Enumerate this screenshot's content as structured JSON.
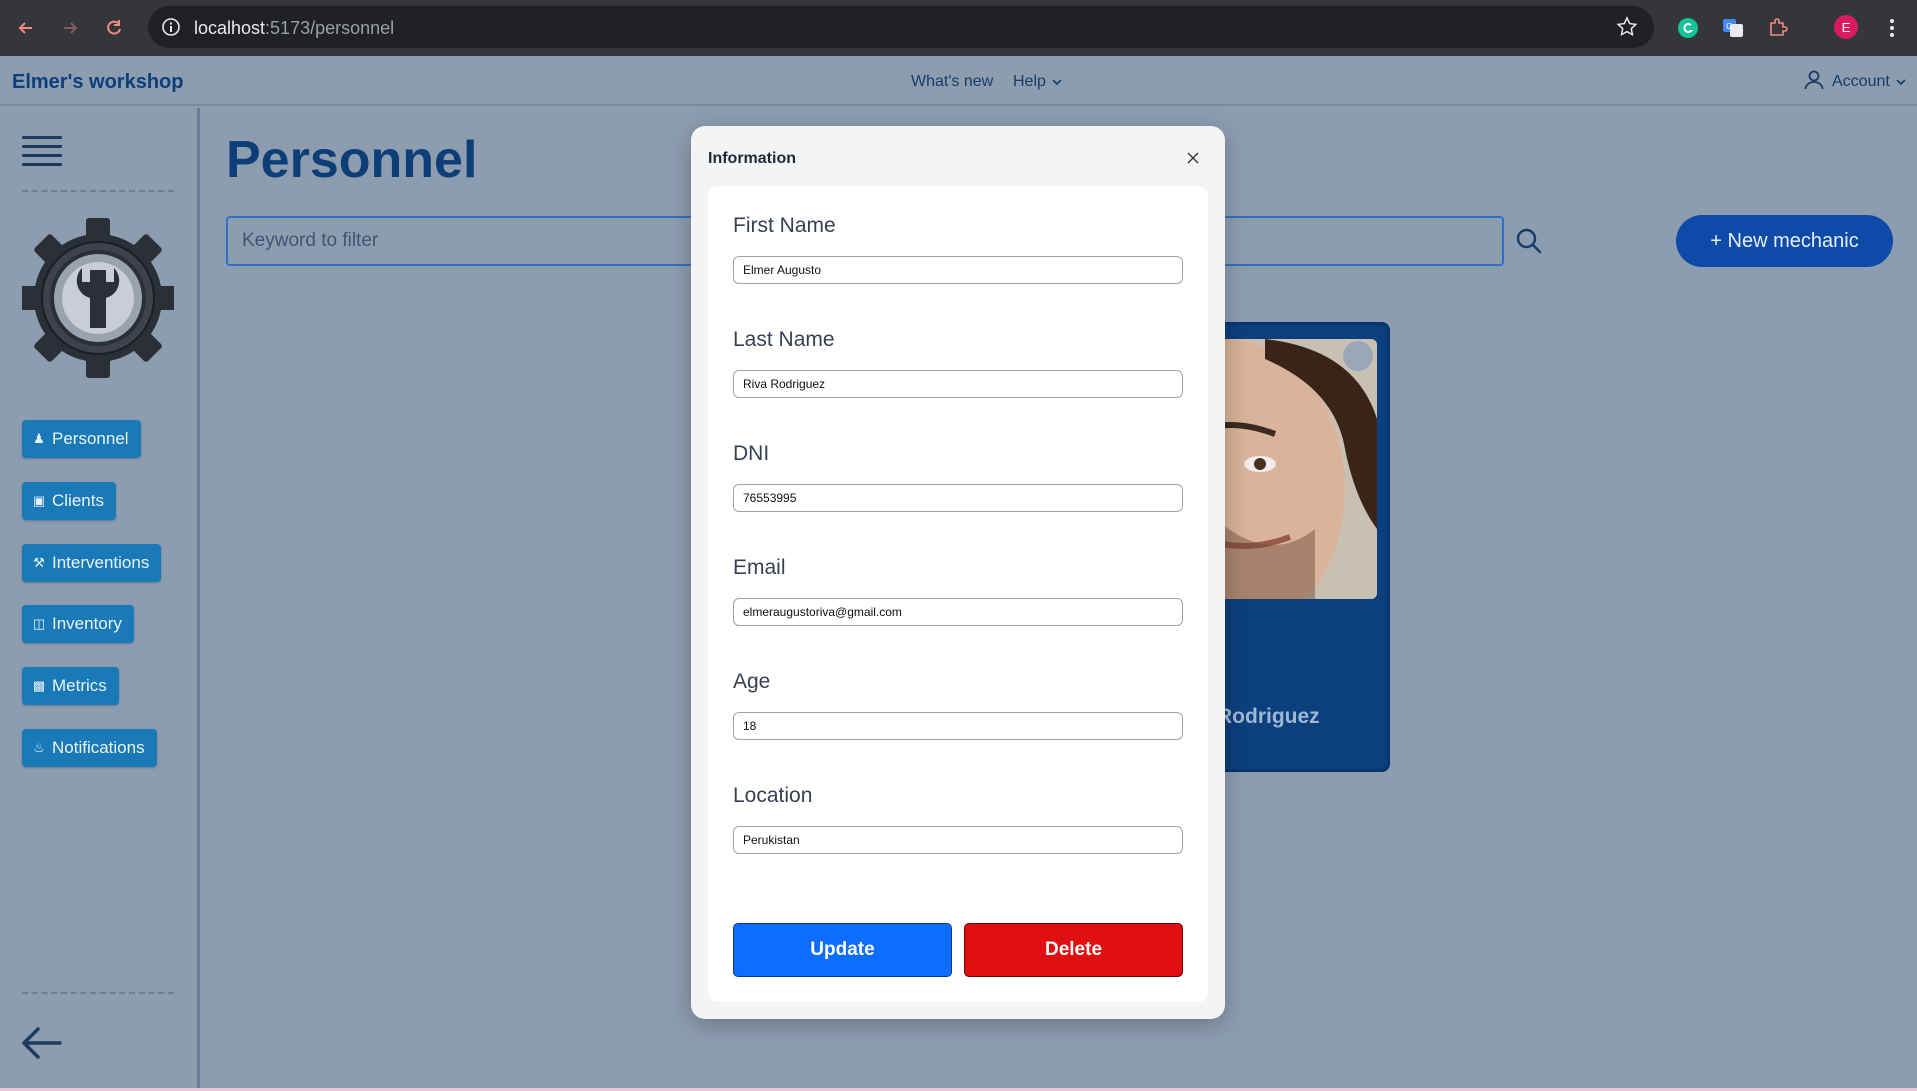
{
  "browser": {
    "url_host": "localhost",
    "url_path": ":5173/personnel",
    "profile_initial": "E"
  },
  "header": {
    "brand": "Elmer's workshop",
    "whats_new": "What's new",
    "help": "Help",
    "account": "Account"
  },
  "sidebar": {
    "items": [
      {
        "label": "Personnel",
        "icon": "users-icon"
      },
      {
        "label": "Clients",
        "icon": "id-card-icon"
      },
      {
        "label": "Interventions",
        "icon": "hammer-icon"
      },
      {
        "label": "Inventory",
        "icon": "box-icon"
      },
      {
        "label": "Metrics",
        "icon": "bar-chart-icon"
      },
      {
        "label": "Notifications",
        "icon": "bell-icon"
      }
    ]
  },
  "main": {
    "title": "Personnel",
    "filter_placeholder": "Keyword to filter",
    "new_button": "+ New mechanic",
    "card_name": "Rodriguez"
  },
  "modal": {
    "title": "Information",
    "fields": [
      {
        "label": "First Name",
        "value": "Elmer Augusto"
      },
      {
        "label": "Last Name",
        "value": "Riva Rodriguez"
      },
      {
        "label": "DNI",
        "value": "76553995"
      },
      {
        "label": "Email",
        "value": "elmeraugustoriva@gmail.com"
      },
      {
        "label": "Age",
        "value": "18"
      },
      {
        "label": "Location",
        "value": "Perukistan"
      }
    ],
    "update_label": "Update",
    "delete_label": "Delete"
  },
  "colors": {
    "accent": "#0e4aa8",
    "sidebar_button": "#1a7ab8",
    "update": "#0d6efd",
    "delete": "#e01010"
  }
}
